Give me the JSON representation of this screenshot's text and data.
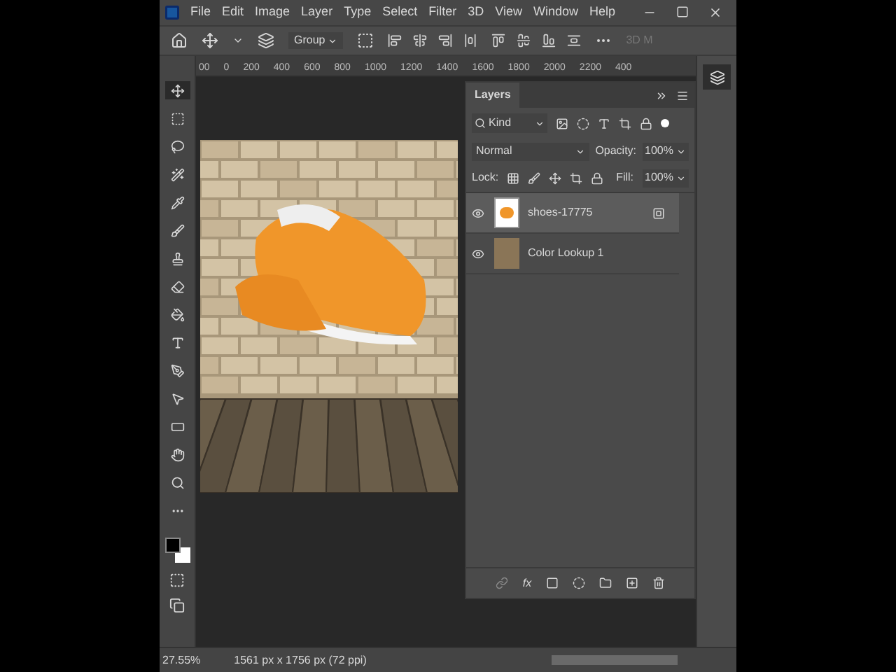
{
  "menu": [
    "File",
    "Edit",
    "Image",
    "Layer",
    "Type",
    "Select",
    "Filter",
    "3D",
    "View",
    "Window",
    "Help"
  ],
  "options_bar": {
    "auto_select": "Group",
    "cut_label": "3D M"
  },
  "ruler": [
    "00",
    "0",
    "200",
    "400",
    "600",
    "800",
    "1000",
    "1200",
    "1400",
    "1600",
    "1800",
    "2000",
    "2200",
    "400"
  ],
  "tools": [
    {
      "kind": "move",
      "selected": true
    },
    {
      "kind": "marquee",
      "selected": false
    },
    {
      "kind": "lasso",
      "selected": false
    },
    {
      "kind": "wand",
      "selected": false
    },
    {
      "kind": "eyedropper",
      "selected": false
    },
    {
      "kind": "brush",
      "selected": false
    },
    {
      "kind": "stamp",
      "selected": false
    },
    {
      "kind": "eraser",
      "selected": false
    },
    {
      "kind": "bucket",
      "selected": false
    },
    {
      "kind": "type",
      "selected": false
    },
    {
      "kind": "pen",
      "selected": false
    },
    {
      "kind": "select",
      "selected": false
    },
    {
      "kind": "rectangle",
      "selected": false
    },
    {
      "kind": "hand",
      "selected": false
    },
    {
      "kind": "zoom",
      "selected": false
    },
    {
      "kind": "more",
      "selected": false
    }
  ],
  "layers_panel": {
    "title": "Layers",
    "filter": "Kind",
    "blend_mode": "Normal",
    "opacity_label": "Opacity:",
    "opacity": "100%",
    "lock_label": "Lock:",
    "fill_label": "Fill:",
    "fill": "100%",
    "fx": "fx",
    "layers": [
      {
        "name": "shoes-17775",
        "kind": "smart",
        "selected": true,
        "visible": true
      },
      {
        "name": "Color Lookup 1",
        "kind": "adjustment",
        "selected": false,
        "visible": true
      }
    ]
  },
  "status_bar": {
    "zoom": "27.55%",
    "doc_size": "1561 px x 1756 px (72 ppi)"
  }
}
